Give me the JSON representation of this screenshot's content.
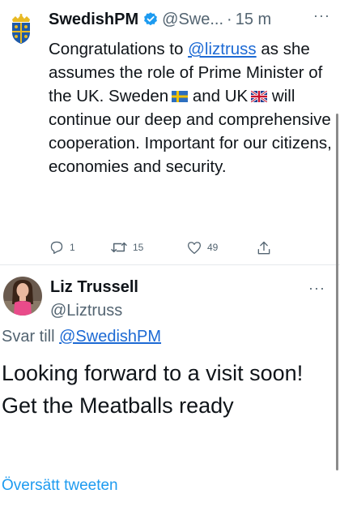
{
  "tweet1": {
    "author_name": "SwedishPM",
    "handle": "@Swe...",
    "separator": "·",
    "time": "15 m",
    "more_label": "···",
    "text_part1": "Congratulations to ",
    "mention": "@liztruss",
    "text_part2": " as she assumes the role of Prime Minister of the UK. Sweden",
    "text_part3": " and UK",
    "text_part4": " will continue our deep and comprehensive cooperation. Important for our citizens, economies and security.",
    "flag_sweden_icon": "sweden-flag-icon",
    "flag_uk_icon": "uk-flag-icon",
    "actions": {
      "reply_count": "1",
      "retweet_count": "15",
      "like_count": "49"
    }
  },
  "tweet2": {
    "author_name": "Liz Trussell",
    "handle": "@Liztruss",
    "more_label": "···",
    "reply_prefix": "Svar till ",
    "reply_mention": "@SwedishPM",
    "text": "Looking forward to a visit soon! Get the Meatballs ready",
    "translate_label": "Översätt tweeten"
  },
  "colors": {
    "link": "#1d6ad4",
    "accent": "#1d9bf0",
    "muted": "#536471",
    "verified": "#1d9bf0"
  }
}
